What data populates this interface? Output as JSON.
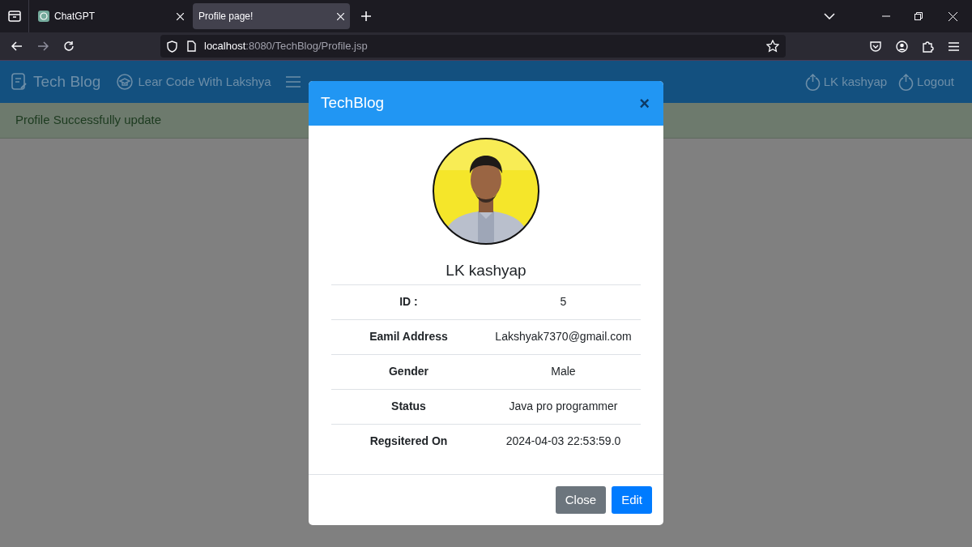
{
  "browser": {
    "tabs": [
      {
        "title": "ChatGPT",
        "selected": false
      },
      {
        "title": "Profile page!",
        "selected": true
      }
    ],
    "url": {
      "host": "localhost",
      "path": ":8080/TechBlog/Profile.jsp"
    }
  },
  "navbar": {
    "brand": "Tech Blog",
    "links": [
      {
        "label": "Lear Code With Lakshya",
        "kind": "course"
      },
      {
        "kind": "menu"
      }
    ],
    "right": [
      {
        "label": "LK kashyap"
      },
      {
        "label": "Logout"
      }
    ]
  },
  "alert": "Profile Successfully update",
  "modal": {
    "title": "TechBlog",
    "close_glyph": "×",
    "name": "LK kashyap",
    "rows": [
      {
        "label": "ID :",
        "value": "5"
      },
      {
        "label": "Eamil Address",
        "value": "Lakshyak7370@gmail.com"
      },
      {
        "label": "Gender",
        "value": "Male"
      },
      {
        "label": "Status",
        "value": "Java pro programmer"
      },
      {
        "label": "Regsitered On",
        "value": "2024-04-03 22:53:59.0"
      }
    ],
    "buttons": [
      {
        "label": "Close",
        "kind": "secondary"
      },
      {
        "label": "Edit",
        "kind": "primary"
      }
    ]
  }
}
